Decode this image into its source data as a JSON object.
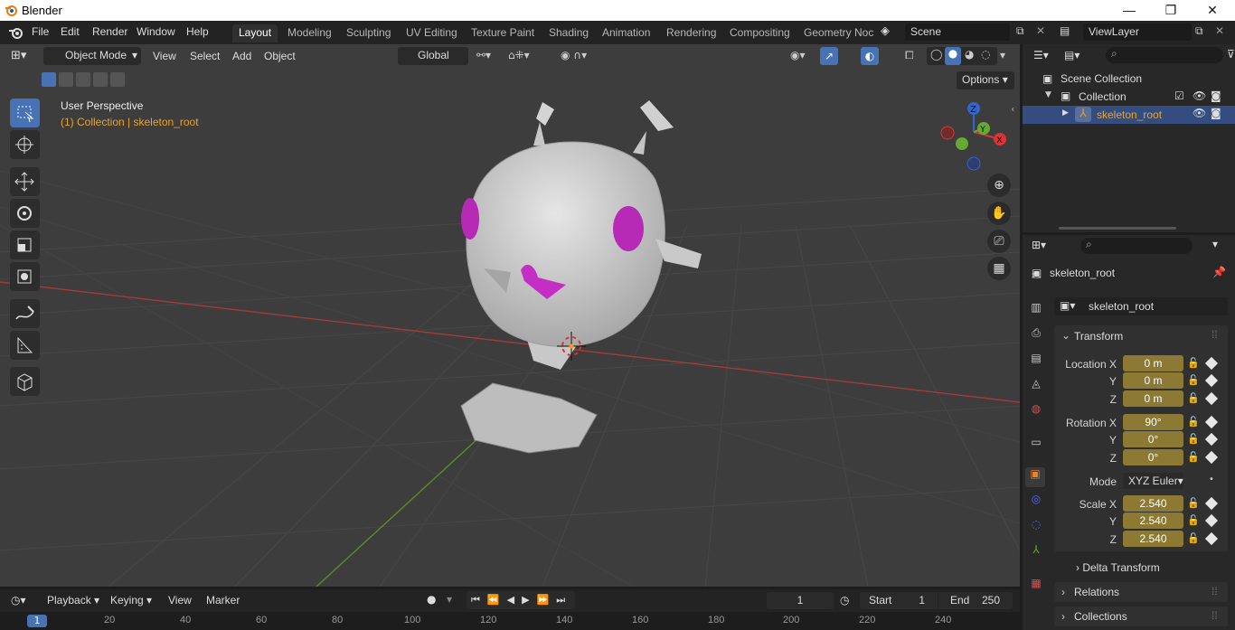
{
  "app": {
    "title": "Blender",
    "minimize": "—",
    "maximize": "❐",
    "close": "✕"
  },
  "menu": {
    "file": "File",
    "edit": "Edit",
    "render": "Render",
    "window": "Window",
    "help": "Help"
  },
  "workspaces": [
    "Layout",
    "Modeling",
    "Sculpting",
    "UV Editing",
    "Texture Paint",
    "Shading",
    "Animation",
    "Rendering",
    "Compositing",
    "Geometry Noc"
  ],
  "scene": {
    "name": "Scene"
  },
  "view_layer": {
    "name": "ViewLayer"
  },
  "viewport": {
    "mode": "Object Mode",
    "menus": [
      "View",
      "Select",
      "Add",
      "Object"
    ],
    "orientation": "Global",
    "options": "Options",
    "perspective": "User Perspective",
    "collection_info": "(1) Collection | skeleton_root"
  },
  "gizmo": {
    "x": "X",
    "y": "Y",
    "z": "Z"
  },
  "outliner": {
    "scene_collection": "Scene Collection",
    "collection": "Collection",
    "object": "skeleton_root"
  },
  "properties": {
    "object_name": "skeleton_root",
    "object_field": "skeleton_root",
    "transform_label": "Transform",
    "location": {
      "x_label": "Location X",
      "y_label": "Y",
      "z_label": "Z",
      "x": "0 m",
      "y": "0 m",
      "z": "0 m"
    },
    "rotation": {
      "x_label": "Rotation X",
      "y_label": "Y",
      "z_label": "Z",
      "x": "90°",
      "y": "0°",
      "z": "0°"
    },
    "mode_label": "Mode",
    "mode_value": "XYZ Euler",
    "scale": {
      "x_label": "Scale X",
      "y_label": "Y",
      "z_label": "Z",
      "x": "2.540",
      "y": "2.540",
      "z": "2.540"
    },
    "delta_transform": "Delta Transform",
    "relations": "Relations",
    "collections": "Collections"
  },
  "timeline": {
    "playback": "Playback",
    "keying": "Keying",
    "view": "View",
    "marker": "Marker",
    "current_frame": "1",
    "start_label": "Start",
    "start": "1",
    "end_label": "End",
    "end": "250",
    "ruler_current": "1",
    "ruler_ticks": [
      "20",
      "40",
      "60",
      "80",
      "100",
      "120",
      "140",
      "160",
      "180",
      "200",
      "220",
      "240"
    ]
  },
  "colors": {
    "accent": "#4772b3",
    "animated_field": "#8c7a34",
    "selected_text": "#e8a331",
    "viewport_bg": "#3d3d3d",
    "eye_color": "#b62ab6"
  }
}
